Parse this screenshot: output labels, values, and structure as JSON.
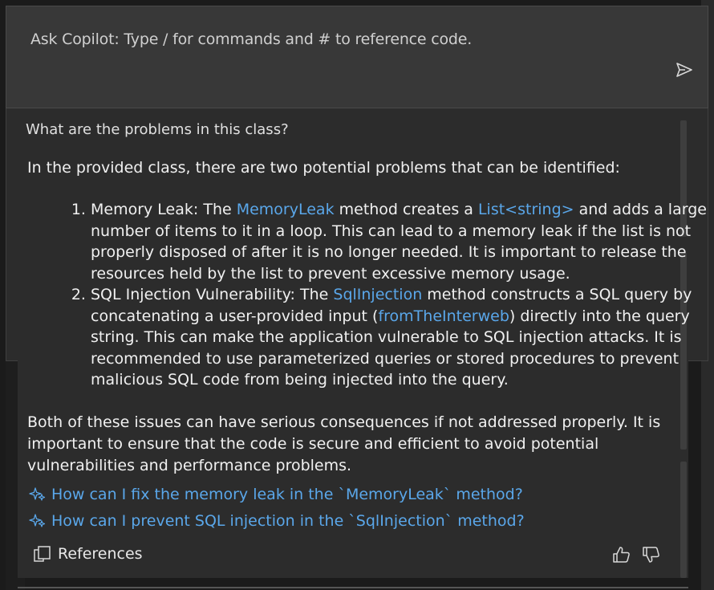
{
  "input": {
    "placeholder": "Ask Copilot: Type / for commands and # to reference code."
  },
  "chat": {
    "question": "What are the problems in this class?",
    "intro": "In the provided class, there are two potential problems that can be identified:",
    "items": [
      {
        "seg1": "Memory Leak: The ",
        "code1": "MemoryLeak",
        "seg2": " method creates a ",
        "code2": "List<string>",
        "seg3": " and adds a large number of items to it in a loop. This can lead to a memory leak if the list is not properly disposed of after it is no longer needed. It is important to release the resources held by the list to prevent excessive memory usage."
      },
      {
        "seg1": "SQL Injection Vulnerability: The ",
        "code1": "SqlInjection",
        "seg2": " method constructs a SQL query by concatenating a user-provided input (",
        "code2": "fromTheInterweb",
        "seg3": ") directly into the query string. This can make the application vulnerable to SQL injection attacks. It is recommended to use parameterized queries or stored procedures to prevent malicious SQL code from being injected into the query."
      }
    ],
    "summary": "Both of these issues can have serious consequences if not addressed properly. It is important to ensure that the code is secure and efficient to avoid potential vulnerabilities and performance problems.",
    "suggestions": [
      "How can I fix the memory leak in the `MemoryLeak` method?",
      "How can I prevent SQL injection in the `SqlInjection` method?"
    ],
    "references_label": "References"
  },
  "icons": {
    "send": "send-icon",
    "sparkle": "sparkle-icon",
    "references": "references-icon",
    "thumbs_up": "thumbs-up-icon",
    "thumbs_down": "thumbs-down-icon"
  },
  "colors": {
    "background": "#1b1b1b",
    "panel": "#2c2c2c",
    "input": "#383838",
    "link": "#5aa7ea",
    "text": "#f0f0f0"
  }
}
